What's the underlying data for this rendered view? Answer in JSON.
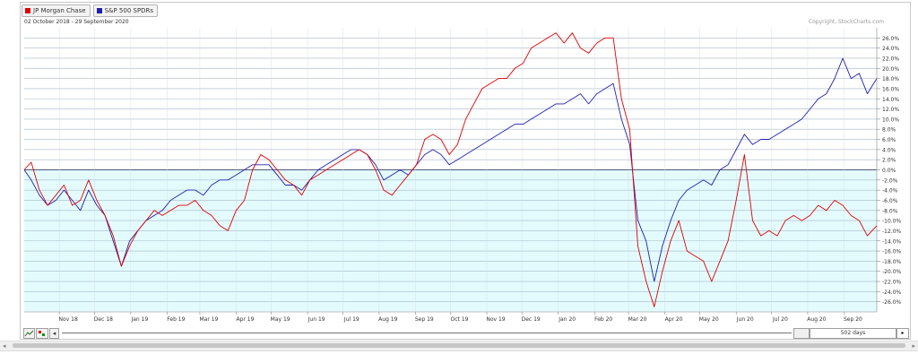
{
  "legend": {
    "items": [
      {
        "label": "JP Morgan Chase",
        "color": "#e00000"
      },
      {
        "label": "S&P 500 SPDRs",
        "color": "#2020b0"
      }
    ]
  },
  "date_range": "02 October 2018 - 29 September 2020",
  "copyright": "Copyright, StockCharts.com",
  "toolbar": {
    "range_label": "502 days"
  },
  "chart_data": {
    "type": "line",
    "title": "",
    "y_unit": "%",
    "ylim": [
      -28,
      28
    ],
    "y_ticks": [
      26,
      24,
      22,
      20,
      18,
      16,
      14,
      12,
      10,
      8,
      6,
      4,
      2,
      0,
      -2,
      -4,
      -6,
      -8,
      -10,
      -12,
      -14,
      -16,
      -18,
      -20,
      -22,
      -24,
      -26
    ],
    "y_tick_labels": [
      "26.0%",
      "24.0%",
      "22.0%",
      "20.0%",
      "18.0%",
      "16.0%",
      "14.0%",
      "12.0%",
      "10.0%",
      "8.0%",
      "6.0%",
      "4.0%",
      "2.0%",
      "0.0%",
      "-2.0%",
      "-4.0%",
      "-6.0%",
      "-8.0%",
      "-10.0%",
      "-12.0%",
      "-14.0%",
      "-16.0%",
      "-18.0%",
      "-20.0%",
      "-22.0%",
      "-24.0%",
      "-26.0%"
    ],
    "x_range": [
      "2018-10-02",
      "2020-09-29"
    ],
    "x_tick_labels": [
      {
        "label": "Nov 18",
        "date": "2018-11-01"
      },
      {
        "label": "Dec 18",
        "date": "2018-12-01"
      },
      {
        "label": "Jan 19",
        "date": "2019-01-01"
      },
      {
        "label": "Feb 19",
        "date": "2019-02-01"
      },
      {
        "label": "Mar 19",
        "date": "2019-03-01"
      },
      {
        "label": "Apr 19",
        "date": "2019-04-01"
      },
      {
        "label": "May 19",
        "date": "2019-05-01"
      },
      {
        "label": "Jun 19",
        "date": "2019-06-01"
      },
      {
        "label": "Jul 19",
        "date": "2019-07-01"
      },
      {
        "label": "Aug 19",
        "date": "2019-08-01"
      },
      {
        "label": "Sep 19",
        "date": "2019-09-01"
      },
      {
        "label": "Oct 19",
        "date": "2019-10-01"
      },
      {
        "label": "Nov 19",
        "date": "2019-11-01"
      },
      {
        "label": "Dec 19",
        "date": "2019-12-01"
      },
      {
        "label": "Jan 20",
        "date": "2020-01-01"
      },
      {
        "label": "Feb 20",
        "date": "2020-02-01"
      },
      {
        "label": "Mar 20",
        "date": "2020-03-01"
      },
      {
        "label": "Apr 20",
        "date": "2020-04-01"
      },
      {
        "label": "May 20",
        "date": "2020-05-01"
      },
      {
        "label": "Jun 20",
        "date": "2020-06-01"
      },
      {
        "label": "Jul 20",
        "date": "2020-07-01"
      },
      {
        "label": "Aug 20",
        "date": "2020-08-01"
      },
      {
        "label": "Sep 20",
        "date": "2020-09-01"
      }
    ],
    "series": [
      {
        "name": "JP Morgan Chase",
        "color": "#e00000",
        "points": [
          [
            "2018-10-02",
            0
          ],
          [
            "2018-10-08",
            1.5
          ],
          [
            "2018-10-15",
            -4
          ],
          [
            "2018-10-22",
            -7
          ],
          [
            "2018-10-29",
            -5
          ],
          [
            "2018-11-05",
            -3
          ],
          [
            "2018-11-12",
            -7
          ],
          [
            "2018-11-19",
            -6
          ],
          [
            "2018-11-26",
            -2
          ],
          [
            "2018-12-03",
            -6
          ],
          [
            "2018-12-10",
            -9
          ],
          [
            "2018-12-17",
            -13
          ],
          [
            "2018-12-24",
            -19
          ],
          [
            "2018-12-31",
            -15
          ],
          [
            "2019-01-07",
            -12
          ],
          [
            "2019-01-14",
            -10
          ],
          [
            "2019-01-21",
            -8
          ],
          [
            "2019-01-28",
            -9
          ],
          [
            "2019-02-04",
            -8
          ],
          [
            "2019-02-11",
            -7
          ],
          [
            "2019-02-18",
            -7
          ],
          [
            "2019-02-25",
            -6
          ],
          [
            "2019-03-04",
            -8
          ],
          [
            "2019-03-11",
            -9
          ],
          [
            "2019-03-18",
            -11
          ],
          [
            "2019-03-25",
            -12
          ],
          [
            "2019-04-01",
            -8
          ],
          [
            "2019-04-08",
            -6
          ],
          [
            "2019-04-15",
            0
          ],
          [
            "2019-04-22",
            3
          ],
          [
            "2019-04-29",
            2
          ],
          [
            "2019-05-06",
            0
          ],
          [
            "2019-05-13",
            -2
          ],
          [
            "2019-05-20",
            -3
          ],
          [
            "2019-05-27",
            -5
          ],
          [
            "2019-06-03",
            -2
          ],
          [
            "2019-06-10",
            -1
          ],
          [
            "2019-06-17",
            0
          ],
          [
            "2019-06-24",
            1
          ],
          [
            "2019-07-01",
            2
          ],
          [
            "2019-07-08",
            3
          ],
          [
            "2019-07-15",
            4
          ],
          [
            "2019-07-22",
            3
          ],
          [
            "2019-07-29",
            0
          ],
          [
            "2019-08-05",
            -4
          ],
          [
            "2019-08-12",
            -5
          ],
          [
            "2019-08-19",
            -3
          ],
          [
            "2019-08-26",
            -1
          ],
          [
            "2019-09-02",
            1
          ],
          [
            "2019-09-09",
            6
          ],
          [
            "2019-09-16",
            7
          ],
          [
            "2019-09-23",
            6
          ],
          [
            "2019-09-30",
            3
          ],
          [
            "2019-10-07",
            5
          ],
          [
            "2019-10-14",
            10
          ],
          [
            "2019-10-21",
            13
          ],
          [
            "2019-10-28",
            16
          ],
          [
            "2019-11-04",
            17
          ],
          [
            "2019-11-11",
            18
          ],
          [
            "2019-11-18",
            18
          ],
          [
            "2019-11-25",
            20
          ],
          [
            "2019-12-02",
            21
          ],
          [
            "2019-12-09",
            24
          ],
          [
            "2019-12-16",
            25
          ],
          [
            "2019-12-23",
            26
          ],
          [
            "2019-12-30",
            27
          ],
          [
            "2020-01-06",
            25
          ],
          [
            "2020-01-13",
            27
          ],
          [
            "2020-01-20",
            24
          ],
          [
            "2020-01-27",
            23
          ],
          [
            "2020-02-03",
            25
          ],
          [
            "2020-02-10",
            26
          ],
          [
            "2020-02-17",
            26
          ],
          [
            "2020-02-24",
            14
          ],
          [
            "2020-03-02",
            8
          ],
          [
            "2020-03-09",
            -15
          ],
          [
            "2020-03-16",
            -22
          ],
          [
            "2020-03-23",
            -27
          ],
          [
            "2020-03-30",
            -20
          ],
          [
            "2020-04-06",
            -14
          ],
          [
            "2020-04-13",
            -10
          ],
          [
            "2020-04-20",
            -16
          ],
          [
            "2020-04-27",
            -17
          ],
          [
            "2020-05-04",
            -18
          ],
          [
            "2020-05-11",
            -22
          ],
          [
            "2020-05-18",
            -18
          ],
          [
            "2020-05-25",
            -14
          ],
          [
            "2020-06-01",
            -6
          ],
          [
            "2020-06-08",
            3
          ],
          [
            "2020-06-15",
            -10
          ],
          [
            "2020-06-22",
            -13
          ],
          [
            "2020-06-29",
            -12
          ],
          [
            "2020-07-06",
            -13
          ],
          [
            "2020-07-13",
            -10
          ],
          [
            "2020-07-20",
            -9
          ],
          [
            "2020-07-27",
            -10
          ],
          [
            "2020-08-03",
            -9
          ],
          [
            "2020-08-10",
            -7
          ],
          [
            "2020-08-17",
            -8
          ],
          [
            "2020-08-24",
            -6
          ],
          [
            "2020-08-31",
            -7
          ],
          [
            "2020-09-07",
            -9
          ],
          [
            "2020-09-14",
            -10
          ],
          [
            "2020-09-21",
            -13
          ],
          [
            "2020-09-29",
            -11
          ]
        ]
      },
      {
        "name": "S&P 500 SPDRs",
        "color": "#2020b0",
        "points": [
          [
            "2018-10-02",
            0
          ],
          [
            "2018-10-08",
            -2
          ],
          [
            "2018-10-15",
            -5
          ],
          [
            "2018-10-22",
            -7
          ],
          [
            "2018-10-29",
            -6
          ],
          [
            "2018-11-05",
            -4
          ],
          [
            "2018-11-12",
            -6
          ],
          [
            "2018-11-19",
            -8
          ],
          [
            "2018-11-26",
            -4
          ],
          [
            "2018-12-03",
            -7
          ],
          [
            "2018-12-10",
            -9
          ],
          [
            "2018-12-17",
            -14
          ],
          [
            "2018-12-24",
            -19
          ],
          [
            "2018-12-31",
            -14
          ],
          [
            "2019-01-07",
            -12
          ],
          [
            "2019-01-14",
            -10
          ],
          [
            "2019-01-21",
            -9
          ],
          [
            "2019-01-28",
            -8
          ],
          [
            "2019-02-04",
            -6
          ],
          [
            "2019-02-11",
            -5
          ],
          [
            "2019-02-18",
            -4
          ],
          [
            "2019-02-25",
            -4
          ],
          [
            "2019-03-04",
            -5
          ],
          [
            "2019-03-11",
            -3
          ],
          [
            "2019-03-18",
            -2
          ],
          [
            "2019-03-25",
            -2
          ],
          [
            "2019-04-01",
            -1
          ],
          [
            "2019-04-08",
            0
          ],
          [
            "2019-04-15",
            1
          ],
          [
            "2019-04-22",
            1
          ],
          [
            "2019-04-29",
            1
          ],
          [
            "2019-05-06",
            -1
          ],
          [
            "2019-05-13",
            -3
          ],
          [
            "2019-05-20",
            -3
          ],
          [
            "2019-05-27",
            -4
          ],
          [
            "2019-06-03",
            -2
          ],
          [
            "2019-06-10",
            0
          ],
          [
            "2019-06-17",
            1
          ],
          [
            "2019-06-24",
            2
          ],
          [
            "2019-07-01",
            3
          ],
          [
            "2019-07-08",
            4
          ],
          [
            "2019-07-15",
            4
          ],
          [
            "2019-07-22",
            3
          ],
          [
            "2019-07-29",
            1
          ],
          [
            "2019-08-05",
            -2
          ],
          [
            "2019-08-12",
            -1
          ],
          [
            "2019-08-19",
            0
          ],
          [
            "2019-08-26",
            -1
          ],
          [
            "2019-09-02",
            1
          ],
          [
            "2019-09-09",
            3
          ],
          [
            "2019-09-16",
            4
          ],
          [
            "2019-09-23",
            3
          ],
          [
            "2019-09-30",
            1
          ],
          [
            "2019-10-07",
            2
          ],
          [
            "2019-10-14",
            3
          ],
          [
            "2019-10-21",
            4
          ],
          [
            "2019-10-28",
            5
          ],
          [
            "2019-11-04",
            6
          ],
          [
            "2019-11-11",
            7
          ],
          [
            "2019-11-18",
            8
          ],
          [
            "2019-11-25",
            9
          ],
          [
            "2019-12-02",
            9
          ],
          [
            "2019-12-09",
            10
          ],
          [
            "2019-12-16",
            11
          ],
          [
            "2019-12-23",
            12
          ],
          [
            "2019-12-30",
            13
          ],
          [
            "2020-01-06",
            13
          ],
          [
            "2020-01-13",
            14
          ],
          [
            "2020-01-20",
            15
          ],
          [
            "2020-01-27",
            13
          ],
          [
            "2020-02-03",
            15
          ],
          [
            "2020-02-10",
            16
          ],
          [
            "2020-02-17",
            17
          ],
          [
            "2020-02-24",
            10
          ],
          [
            "2020-03-02",
            5
          ],
          [
            "2020-03-09",
            -10
          ],
          [
            "2020-03-16",
            -14
          ],
          [
            "2020-03-23",
            -22
          ],
          [
            "2020-03-30",
            -15
          ],
          [
            "2020-04-06",
            -10
          ],
          [
            "2020-04-13",
            -6
          ],
          [
            "2020-04-20",
            -4
          ],
          [
            "2020-04-27",
            -3
          ],
          [
            "2020-05-04",
            -2
          ],
          [
            "2020-05-11",
            -3
          ],
          [
            "2020-05-18",
            0
          ],
          [
            "2020-05-25",
            1
          ],
          [
            "2020-06-01",
            4
          ],
          [
            "2020-06-08",
            7
          ],
          [
            "2020-06-15",
            5
          ],
          [
            "2020-06-22",
            6
          ],
          [
            "2020-06-29",
            6
          ],
          [
            "2020-07-06",
            7
          ],
          [
            "2020-07-13",
            8
          ],
          [
            "2020-07-20",
            9
          ],
          [
            "2020-07-27",
            10
          ],
          [
            "2020-08-03",
            12
          ],
          [
            "2020-08-10",
            14
          ],
          [
            "2020-08-17",
            15
          ],
          [
            "2020-08-24",
            18
          ],
          [
            "2020-08-31",
            22
          ],
          [
            "2020-09-07",
            18
          ],
          [
            "2020-09-14",
            19
          ],
          [
            "2020-09-21",
            15
          ],
          [
            "2020-09-29",
            18
          ]
        ]
      }
    ]
  }
}
